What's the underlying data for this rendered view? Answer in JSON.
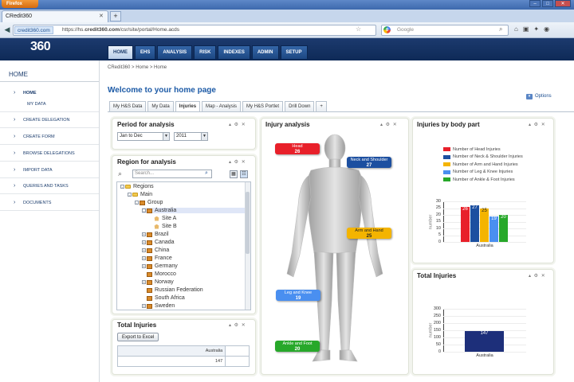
{
  "browser": {
    "app_button": "Firefox",
    "tab_title": "CRedit360",
    "url_host": "credit360.com",
    "url_prefix": "https://hs.",
    "url_domain": "credit360.com",
    "url_path": "/csr/site/portal/Home.acds",
    "search_placeholder": "Google"
  },
  "app": {
    "logo": "360",
    "topnav": [
      {
        "label": "HOME",
        "active": true
      },
      {
        "label": "EHS"
      },
      {
        "label": "ANALYSIS"
      },
      {
        "label": "RISK"
      },
      {
        "label": "INDEXES"
      },
      {
        "label": "ADMIN"
      },
      {
        "label": "SETUP"
      }
    ]
  },
  "sidebar": {
    "home": "HOME",
    "items": [
      {
        "label": "HOME",
        "arrow": true
      },
      {
        "label": "MY DATA"
      },
      {
        "label": "CREATE DELEGATION",
        "arrow": true
      },
      {
        "label": "CREATE FORM",
        "arrow": true
      },
      {
        "label": "BROWSE DELEGATIONS",
        "arrow": true
      },
      {
        "label": "IMPORT DATA",
        "arrow": true
      },
      {
        "label": "QUERIES AND TASKS",
        "arrow": true
      },
      {
        "label": "DOCUMENTS",
        "arrow": true
      }
    ]
  },
  "main": {
    "breadcrumb": "CRedit360 > Home > Home",
    "welcome": "Welcome to your home page",
    "options": "Options",
    "tabs": [
      {
        "label": "My H&S Data"
      },
      {
        "label": "My Data"
      },
      {
        "label": "Injuries",
        "active": true
      },
      {
        "label": "Map - Analysis"
      },
      {
        "label": "My H&S Portlet"
      },
      {
        "label": "Drill Down"
      },
      {
        "label": "+"
      }
    ]
  },
  "period": {
    "title": "Period for analysis",
    "range": "Jan to Dec",
    "year": "2011"
  },
  "region": {
    "title": "Region for analysis",
    "search_placeholder": "Search...",
    "tree": [
      {
        "label": "Regions",
        "level": 0,
        "icon": "folder",
        "exp": "-"
      },
      {
        "label": "Main",
        "level": 1,
        "icon": "folder",
        "exp": "-"
      },
      {
        "label": "Group",
        "level": 2,
        "icon": "org",
        "exp": "-"
      },
      {
        "label": "Australia",
        "level": 3,
        "icon": "org",
        "exp": "-",
        "selected": true
      },
      {
        "label": "Site A",
        "level": 4,
        "icon": "home"
      },
      {
        "label": "Site B",
        "level": 4,
        "icon": "home"
      },
      {
        "label": "Brazil",
        "level": 3,
        "icon": "org",
        "exp": "+"
      },
      {
        "label": "Canada",
        "level": 3,
        "icon": "org",
        "exp": "+"
      },
      {
        "label": "China",
        "level": 3,
        "icon": "org",
        "exp": "+"
      },
      {
        "label": "France",
        "level": 3,
        "icon": "org",
        "exp": "+"
      },
      {
        "label": "Germany",
        "level": 3,
        "icon": "org",
        "exp": "+"
      },
      {
        "label": "Morocco",
        "level": 3,
        "icon": "org"
      },
      {
        "label": "Norway",
        "level": 3,
        "icon": "org",
        "exp": "+"
      },
      {
        "label": "Russian Federation",
        "level": 3,
        "icon": "org"
      },
      {
        "label": "South Africa",
        "level": 3,
        "icon": "org"
      },
      {
        "label": "Sweden",
        "level": 3,
        "icon": "org",
        "exp": "+"
      }
    ]
  },
  "total_left": {
    "title": "Total Injuries",
    "export_label": "Export to Excel",
    "col_header": "Australia",
    "value": "147"
  },
  "injury": {
    "title": "Injury analysis",
    "labels": [
      {
        "name": "Head",
        "value": "26",
        "color": "#e8202a"
      },
      {
        "name": "Neck and Shoulder",
        "value": "27",
        "color": "#1c4fa0"
      },
      {
        "name": "Arm and Hand",
        "value": "25",
        "color": "#f4b400"
      },
      {
        "name": "Leg and Knee",
        "value": "19",
        "color": "#4a8ff0"
      },
      {
        "name": "Ankle and Foot",
        "value": "20",
        "color": "#27a82a"
      }
    ]
  },
  "body_part": {
    "title": "Injuries by body part",
    "chart_data": {
      "type": "bar",
      "categories": [
        "Australia"
      ],
      "ylabel": "number",
      "ylim": [
        0,
        30
      ],
      "yticks": [
        0,
        5,
        10,
        15,
        20,
        25,
        30
      ],
      "series": [
        {
          "name": "Number of Head Injuries",
          "values": [
            26
          ],
          "color": "#e8202a"
        },
        {
          "name": "Number of Neck & Shoulder Injuries",
          "values": [
            27
          ],
          "color": "#1c4fa0"
        },
        {
          "name": "Number of Arm and Hand Injuries",
          "values": [
            25
          ],
          "color": "#f4b400"
        },
        {
          "name": "Number of Leg & Knee Injuries",
          "values": [
            19
          ],
          "color": "#4a8ff0"
        },
        {
          "name": "Number of Ankle & Foot Injuries",
          "values": [
            20
          ],
          "color": "#27a82a"
        }
      ]
    }
  },
  "total_right": {
    "title": "Total Injuries",
    "chart_data": {
      "type": "bar",
      "categories": [
        "Australia"
      ],
      "ylabel": "number",
      "ylim": [
        0,
        300
      ],
      "yticks": [
        0,
        50,
        100,
        150,
        200,
        250,
        300
      ],
      "series": [
        {
          "values": [
            147
          ],
          "color": "#1d2f7a"
        }
      ]
    }
  }
}
